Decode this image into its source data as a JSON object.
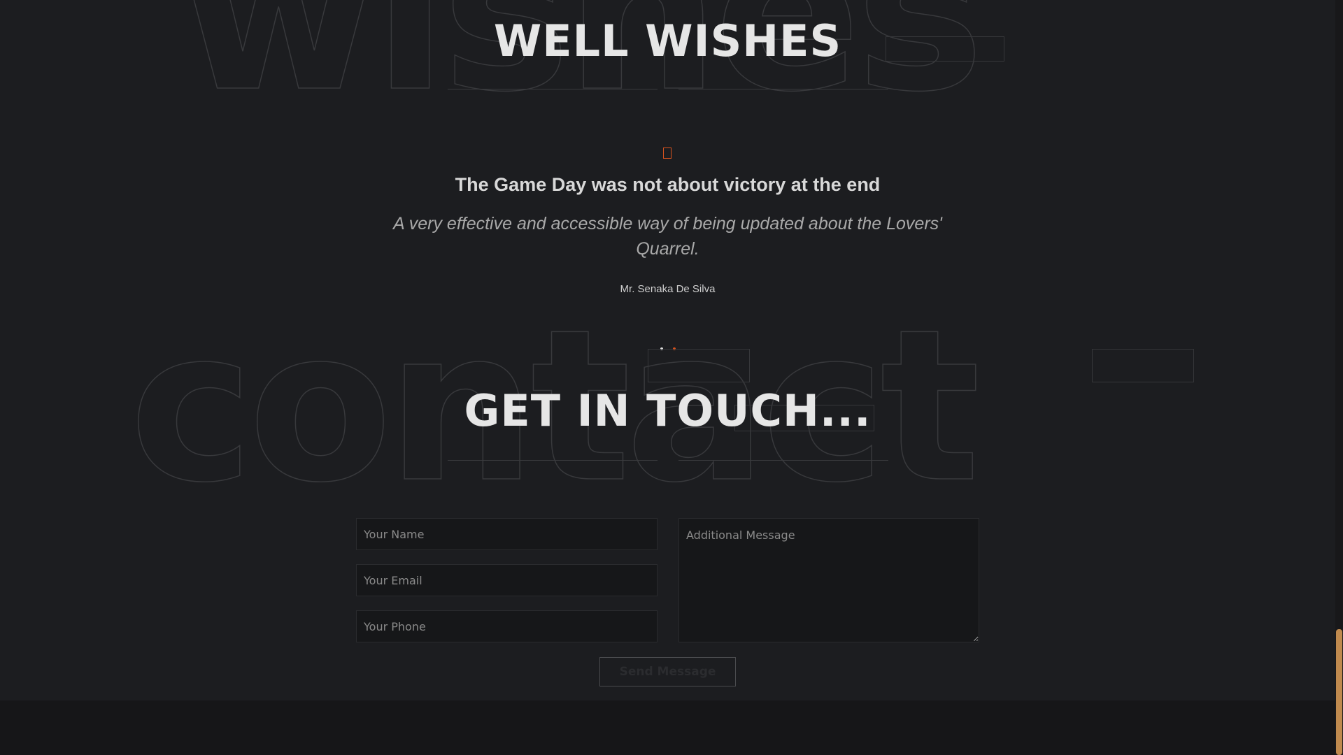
{
  "wishes_section": {
    "bg_word": "wishes",
    "title": "WELL WISHES",
    "quote_icon": "quote-icon",
    "testimonial": {
      "heading": "The Game Day was not about victory at the end",
      "text": "A very effective and accessible way of being updated about the Lovers' Quarrel.",
      "author": "Mr. Senaka De Silva"
    },
    "slider": {
      "dots": 2,
      "active_index": 1,
      "colors": {
        "inactive": "#e0e0e0",
        "active": "#d9531e"
      }
    }
  },
  "contact_section": {
    "bg_word": "contact",
    "title": "GET IN TOUCH...",
    "form": {
      "name_placeholder": "Your Name",
      "email_placeholder": "Your Email",
      "phone_placeholder": "Your Phone",
      "message_placeholder": "Additional Message",
      "submit_label": "Send Message"
    }
  },
  "colors": {
    "background": "#1c1d20",
    "accent": "#d9531e",
    "scrollbar_thumb": "#c08a4e"
  }
}
